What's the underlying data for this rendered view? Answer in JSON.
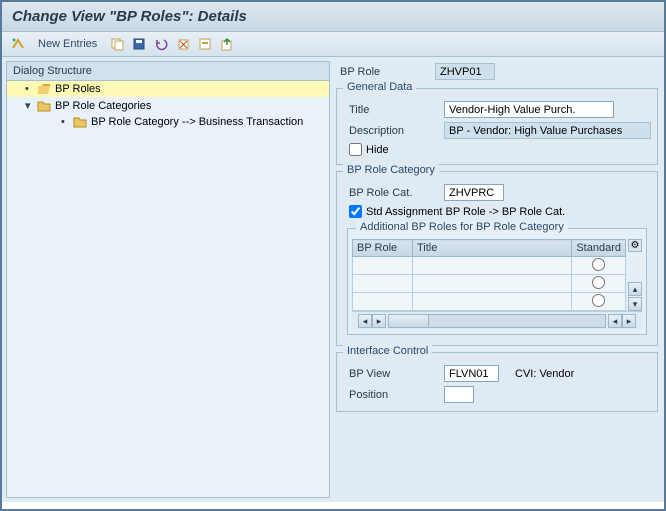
{
  "header": {
    "title": "Change View \"BP Roles\": Details"
  },
  "toolbar": {
    "new_entries": "New Entries"
  },
  "dialog": {
    "header": "Dialog Structure",
    "items": [
      {
        "label": "BP Roles"
      },
      {
        "label": "BP Role Categories"
      },
      {
        "label": "BP Role Category --> Business Transaction"
      }
    ]
  },
  "bp_role": {
    "label": "BP Role",
    "value": "ZHVP01"
  },
  "general": {
    "legend": "General Data",
    "title_label": "Title",
    "title_value": "Vendor-High Value Purch.",
    "desc_label": "Description",
    "desc_value": "BP - Vendor: High Value Purchases",
    "hide_label": "Hide"
  },
  "rolecat": {
    "legend": "BP Role Category",
    "cat_label": "BP Role Cat.",
    "cat_value": "ZHVPRC",
    "std_assign_label": "Std Assignment BP Role -> BP Role Cat.",
    "additional_legend": "Additional BP Roles for BP Role Category",
    "columns": {
      "bprole": "BP Role",
      "title": "Title",
      "standard": "Standard"
    }
  },
  "ifcontrol": {
    "legend": "Interface Control",
    "bpview_label": "BP View",
    "bpview_value": "FLVN01",
    "bpview_desc": "CVI: Vendor",
    "position_label": "Position",
    "position_value": ""
  }
}
